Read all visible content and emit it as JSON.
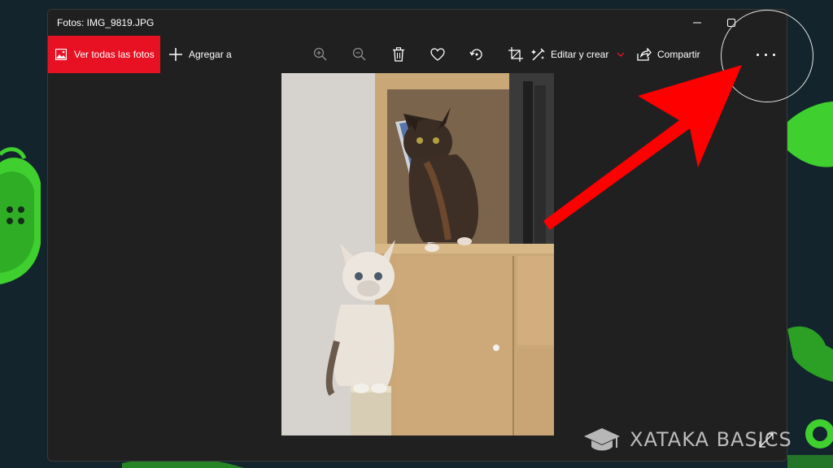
{
  "window": {
    "title": "Fotos: IMG_9819.JPG"
  },
  "toolbar": {
    "all_photos_label": "Ver todas las fotos",
    "add_to_label": "Agregar a",
    "edit_create_label": "Editar y crear",
    "share_label": "Compartir",
    "icons": [
      "image-icon",
      "plus-icon",
      "zoom-in-icon",
      "zoom-out-icon",
      "trash-icon",
      "heart-icon",
      "rotate-icon",
      "crop-icon",
      "edit-create-icon",
      "chevron-down-icon",
      "share-icon",
      "more-icon"
    ]
  },
  "photo": {
    "description_icon": "photo-of-two-kittens"
  },
  "watermark": {
    "text": "XATAKA BASICS",
    "icon": "graduation-cap-icon"
  },
  "colors": {
    "accent": "#e81123",
    "window_bg": "#202020",
    "desktop_bg": "#13242c",
    "arrow": "#ff0000",
    "deco_green": "#4cd43a"
  }
}
